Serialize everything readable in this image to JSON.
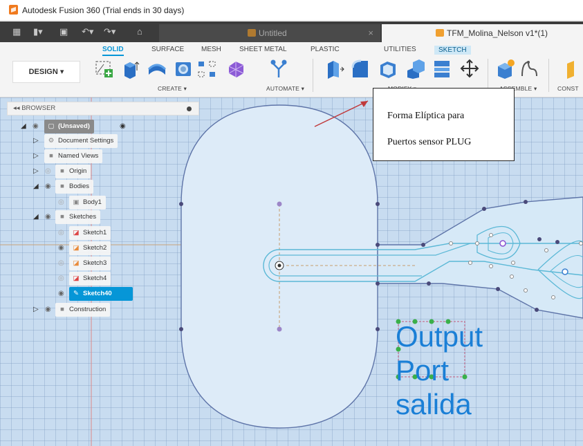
{
  "window": {
    "title": "Autodesk Fusion 360 (Trial ends in 30 days)"
  },
  "tabs": [
    {
      "label": "Untitled",
      "active": false
    },
    {
      "label": "TFM_Molina_Nelson v1*(1)",
      "active": true
    }
  ],
  "workspace_tabs": [
    "SOLID",
    "SURFACE",
    "MESH",
    "SHEET METAL",
    "PLASTIC",
    "UTILITIES",
    "SKETCH"
  ],
  "toolbar": {
    "design_label": "DESIGN ▾",
    "groups": [
      "CREATE ▾",
      "AUTOMATE ▾",
      "MODIFY ▾",
      "ASSEMBLE ▾",
      "CONST"
    ]
  },
  "browser": {
    "header": "BROWSER",
    "root": "(Unsaved)",
    "items": [
      {
        "label": "Document Settings",
        "icon": "gear-icon"
      },
      {
        "label": "Named Views",
        "icon": "folder-icon"
      },
      {
        "label": "Origin",
        "icon": "folder-icon"
      },
      {
        "label": "Bodies",
        "icon": "folder-icon"
      },
      {
        "label": "Body1",
        "icon": "body-icon"
      },
      {
        "label": "Sketches",
        "icon": "folder-icon"
      },
      {
        "label": "Sketch1",
        "icon": "sketch-icon"
      },
      {
        "label": "Sketch2",
        "icon": "sketch-icon"
      },
      {
        "label": "Sketch3",
        "icon": "sketch-icon"
      },
      {
        "label": "Sketch4",
        "icon": "sketch-icon"
      },
      {
        "label": "Sketch40",
        "icon": "sketch-icon"
      },
      {
        "label": "Construction",
        "icon": "folder-icon"
      }
    ]
  },
  "annotation": {
    "line1": "Forma Elíptica para",
    "line2": "Puertos sensor PLUG"
  },
  "canvas_text": [
    "Output",
    "Port",
    "salida"
  ],
  "colors": {
    "canvas_bg": "#c8dcf0",
    "accent": "#0696d7",
    "sketch_text": "#1a7fd6",
    "annotation_arrow": "#c0393b"
  }
}
